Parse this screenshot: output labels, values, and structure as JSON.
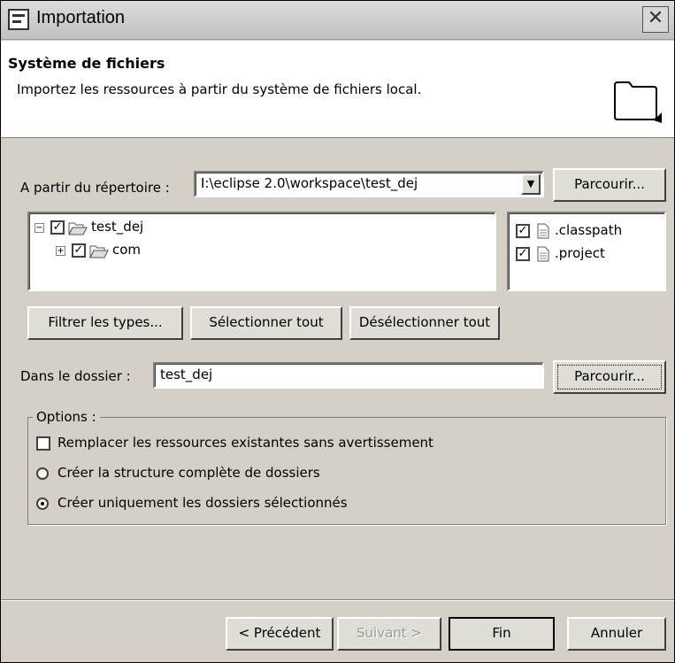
{
  "window": {
    "title": "Importation"
  },
  "header": {
    "title": "Système de fichiers",
    "description": "Importez les ressources à partir du système de fichiers local."
  },
  "source": {
    "label": "A partir du répertoire :",
    "value": "I:\\eclipse 2.0\\workspace\\test_dej",
    "browse_label": "Parcourir..."
  },
  "tree": {
    "items": [
      {
        "label": "test_dej",
        "checked": true,
        "expanded": true
      },
      {
        "label": "com",
        "checked": true,
        "expanded": false
      }
    ]
  },
  "files": {
    "items": [
      {
        "label": ".classpath",
        "checked": true
      },
      {
        "label": ".project",
        "checked": true
      }
    ]
  },
  "selection_buttons": {
    "filter_label": "Filtrer les types...",
    "select_all_label": "Sélectionner tout",
    "deselect_all_label": "Désélectionner tout"
  },
  "destination": {
    "label": "Dans le dossier :",
    "value": "test_dej",
    "browse_label": "Parcourir..."
  },
  "options": {
    "legend": "Options :",
    "overwrite_label": "Remplacer les ressources existantes sans avertissement",
    "overwrite_checked": false,
    "full_structure_label": "Créer la structure complète de dossiers",
    "selected_only_label": "Créer uniquement les dossiers sélectionnés",
    "selected_option": "selected_only"
  },
  "footer": {
    "back_label": "< Précédent",
    "next_label": "Suivant >",
    "finish_label": "Fin",
    "cancel_label": "Annuler"
  }
}
